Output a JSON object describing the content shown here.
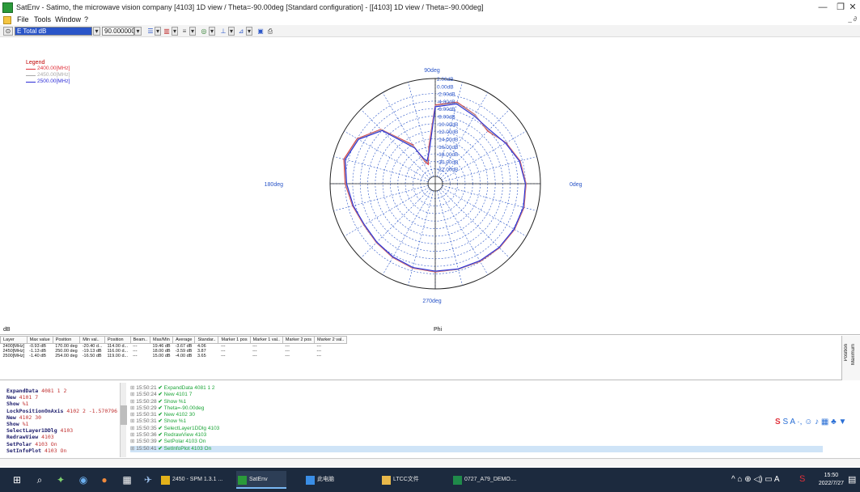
{
  "window": {
    "title": "SatEnv - Satimo, the microwave vision company [4103] 1D view / Theta=-90.00deg [Standard configuration] - [[4103] 1D view / Theta=-90.00deg]",
    "minimize": "—",
    "restore": "❐",
    "close": "✕",
    "mdi_controls": "_ ∂"
  },
  "menu": {
    "file": "File",
    "tools": "Tools",
    "window": "Window",
    "help": "?"
  },
  "toolbar": {
    "quantity": "E Total dB",
    "angle": "90.000000"
  },
  "legend": {
    "title": "Legend",
    "items": [
      {
        "label": "2400.00[MHz]",
        "color": "#e0303a"
      },
      {
        "label": "2450.00[MHz]",
        "color": "#aaaaaa"
      },
      {
        "label": "2500.00[MHz]",
        "color": "#2c2cd6"
      }
    ]
  },
  "chart_data": {
    "type": "polar",
    "angle_labels": [
      "90deg",
      "0deg",
      "180deg",
      "270deg"
    ],
    "radial_unit": "dB",
    "radial_rings": [
      "-2.00dB",
      "-4.00dB",
      "-6.00dB",
      "-8.00dB",
      "-10.00dB",
      "-12.00dB",
      "-14.00dB",
      "-16.00dB",
      "-18.00dB",
      "-20.00dB",
      "-22.00dB"
    ],
    "radial_labels": [
      "2.00dB",
      "0.00dB",
      "-2.00dB",
      "-4.00dB",
      "-6.00dB",
      "-8.00dB",
      "-10.00dB",
      "-12.00dB",
      "-14.00dB",
      "-16.00dB",
      "-18.00dB",
      "-20.00dB",
      "-22.00dB"
    ],
    "rlim": [
      -24,
      2
    ],
    "angles_deg": [
      0,
      15,
      30,
      45,
      60,
      75,
      90,
      100,
      110,
      115,
      120,
      135,
      150,
      165,
      180,
      195,
      210,
      225,
      240,
      255,
      270,
      285,
      300,
      315,
      330,
      345,
      360
    ],
    "series": [
      {
        "name": "2400.00[MHz]",
        "color": "#e0303a",
        "values": [
          -1.8,
          -2.6,
          -4.2,
          -6.2,
          -4.8,
          -3.5,
          -5.0,
          -16.0,
          -20.5,
          -19.5,
          -14.0,
          -5.5,
          -2.0,
          -0.8,
          -2.0,
          -3.2,
          -4.0,
          -3.8,
          -3.3,
          -2.7,
          -2.5,
          -2.4,
          -2.1,
          -1.8,
          -1.6,
          -1.5,
          -1.8
        ]
      },
      {
        "name": "2450.00[MHz]",
        "color": "#aaaaaa",
        "values": [
          -1.9,
          -2.7,
          -4.3,
          -6.0,
          -4.9,
          -3.7,
          -5.2,
          -16.5,
          -20.0,
          -19.0,
          -14.5,
          -5.7,
          -2.2,
          -1.0,
          -2.2,
          -3.3,
          -4.1,
          -3.9,
          -3.4,
          -2.8,
          -2.6,
          -2.4,
          -2.2,
          -1.9,
          -1.7,
          -1.6,
          -1.9
        ]
      },
      {
        "name": "2500.00[MHz]",
        "color": "#2c2cd6",
        "values": [
          -2.0,
          -2.8,
          -4.4,
          -5.6,
          -5.2,
          -4.0,
          -5.5,
          -17.0,
          -19.5,
          -18.5,
          -15.0,
          -6.0,
          -2.4,
          -1.2,
          -2.4,
          -3.4,
          -4.2,
          -4.0,
          -3.5,
          -2.9,
          -2.7,
          -2.5,
          -2.3,
          -2.0,
          -1.8,
          -1.7,
          -2.0
        ]
      }
    ],
    "xlabel": "Phi",
    "ylabel": "dB",
    "grid": true,
    "legend_position": "top-left"
  },
  "axis_footer": {
    "left": "dB",
    "center": "Phi"
  },
  "results_table": {
    "headers": [
      "Layer",
      "Max value",
      "Position",
      "Min val..",
      "Position",
      "Beam..",
      "Max/Min",
      "Average",
      "Standar..",
      "Marker 1 pos",
      "Marker 1 val..",
      "Marker 2 pos",
      "Marker 2 val.."
    ],
    "rows": [
      [
        "2400[MHz]",
        "-0.93 dB",
        "170.00 deg",
        "-20.40 d...",
        "114.00 d...",
        "---",
        "19.46 dB",
        "-3.67 dB",
        "4.06",
        "---",
        "---",
        "---",
        "---"
      ],
      [
        "2450[MHz]",
        "-1.13 dB",
        "250.00 deg",
        "-19.13 dB",
        "116.00 d...",
        "---",
        "18.00 dB",
        "-3.59 dB",
        "3.87",
        "---",
        "---",
        "---",
        "---"
      ],
      [
        "2500[MHz]",
        "-1.40 dB",
        "254.00 deg",
        "-16.50 dB",
        "119.00 d...",
        "---",
        "15.00 dB",
        "-4.00 dB",
        "3.65",
        "---",
        "---",
        "---",
        "---"
      ]
    ]
  },
  "side_tabs": {
    "position": "Position",
    "maximum": "Maximum"
  },
  "script": [
    {
      "cmd": "ExpandData",
      "args": "4081 1 2"
    },
    {
      "cmd": "New",
      "args": "4101 7"
    },
    {
      "cmd": "Show",
      "args": "%1"
    },
    {
      "cmd": "LockPositionOnAxis",
      "args": "4102 2 -1.570796"
    },
    {
      "cmd": "New",
      "args": "4102 30"
    },
    {
      "cmd": "Show",
      "args": "%1"
    },
    {
      "cmd": "SelectLayer1DDlg",
      "args": "4103"
    },
    {
      "cmd": "RedrawView",
      "args": "4103"
    },
    {
      "cmd": "SetPolar",
      "args": "4103 On"
    },
    {
      "cmd": "SetInfoPlot",
      "args": "4103 On"
    }
  ],
  "log": [
    {
      "time": "15:50:21",
      "msg": "ExpandData 4081 1 2"
    },
    {
      "time": "15:50:24",
      "msg": "New 4101 7"
    },
    {
      "time": "15:50:28",
      "msg": "Show %1"
    },
    {
      "time": "15:50:29",
      "msg": "Theta=-90.00deg"
    },
    {
      "time": "15:50:31",
      "msg": "New 4102 30"
    },
    {
      "time": "15:50:31",
      "msg": "Show %1"
    },
    {
      "time": "15:50:35",
      "msg": "SelectLayer1DDlg 4103"
    },
    {
      "time": "15:50:36",
      "msg": "RedrawView 4103"
    },
    {
      "time": "15:50:39",
      "msg": "SetPolar 4103 On"
    },
    {
      "time": "15:50:41",
      "msg": "SetInfoPlot 4103 On"
    }
  ],
  "ime_bar": "S A ·, ☺ ♪ ▦ ♣ ▼",
  "taskbar": {
    "apps": [
      {
        "label": "2450 - SPM 1.3.1 ...",
        "color": "#e2b11a"
      },
      {
        "label": "SatEnv",
        "color": "#2b9a3a"
      },
      {
        "label": "此电脑",
        "color": "#3a8ee6"
      },
      {
        "label": "LTCC文件",
        "color": "#e8b84a"
      },
      {
        "label": "0727_A79_DEMO....",
        "color": "#1f8a4a"
      }
    ],
    "tray": "^ ⌂ ⊕ ◁) ▭ A",
    "time": "15:50",
    "date": "2022/7/27"
  }
}
